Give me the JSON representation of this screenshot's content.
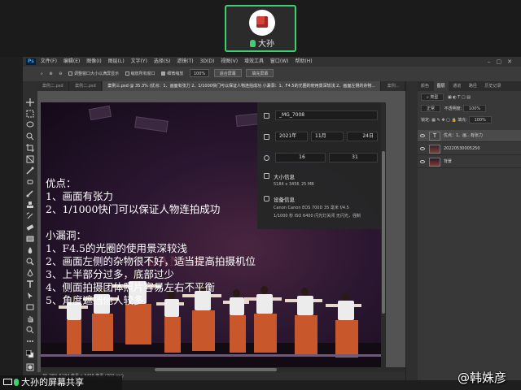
{
  "meeting": {
    "participant_name": "大孙",
    "share_label": "大孙的屏幕共享",
    "watermark": "@韩姝彦"
  },
  "ps": {
    "menu": [
      "文件(F)",
      "编辑(E)",
      "图像(I)",
      "图层(L)",
      "文字(Y)",
      "选择(S)",
      "滤镜(T)",
      "3D(D)",
      "视图(V)",
      "增效工具",
      "窗口(W)",
      "帮助(H)"
    ],
    "options": {
      "resize_windows": "调整窗口大小以满屏显示",
      "zoom_all": "缩放所有窗口",
      "scrubby_zoom": "细微缩放",
      "zoom_level": "100%",
      "fit_screen": "适合屏幕",
      "fill_screen": "填充屏幕"
    },
    "tabs": [
      "案例二.psd",
      "案例二.psd",
      "案例三.psd @ 35.3% (优点：1、画面有张力 2、1/1000快门可以保证人物连拍成功 小漏洞：1、F4.5的光圈的使用景深较浅 2、画面左侧的杂物...",
      "案例..."
    ],
    "status": "35.28%    5184 像素 x 3456 像素 (300 ppi)"
  },
  "canvas": {
    "lines": [
      "优点：",
      "1、画面有张力",
      "2、1/1000快门可以保证人物连拍成功",
      "",
      "小漏洞：",
      "1、F4.5的光圈的使用景深较浅",
      "2、画面左侧的杂物很不好，适当提高拍摄机位",
      "3、上半部分过多，底部过少",
      "4、侧面拍摄团体照片容易左右不平衡",
      "5、角度遮挡他人较多"
    ],
    "sign": "DANCE"
  },
  "props": {
    "filename": "_MG_7008",
    "year": "2021年",
    "month": "11月",
    "day": "24日",
    "hour": "16",
    "minute": "31",
    "size_title": "大小信息",
    "size_dims": "5184 x 3456",
    "size_mb": "25 MB",
    "device_title": "设备信息",
    "device_line1": "Canon    Canon EOS 700D    35 毫米    f/4.5",
    "device_line2": "1/1000 秒    ISO 6400    闪光灯关闭    无闪光，强制"
  },
  "right_panel": {
    "tabs": [
      "颜色",
      "图层",
      "通道",
      "路径",
      "历史记录"
    ],
    "kind": "类型",
    "blend": "正常",
    "opacity_label": "不透明度:",
    "opacity": "100%",
    "lock_label": "锁定:",
    "fill_label": "填充:",
    "fill": "100%",
    "layers": [
      {
        "name": "优点：1、画...有张力",
        "selected": true
      },
      {
        "name": "20220530005250",
        "selected": false
      },
      {
        "name": "背景",
        "selected": false
      }
    ]
  }
}
